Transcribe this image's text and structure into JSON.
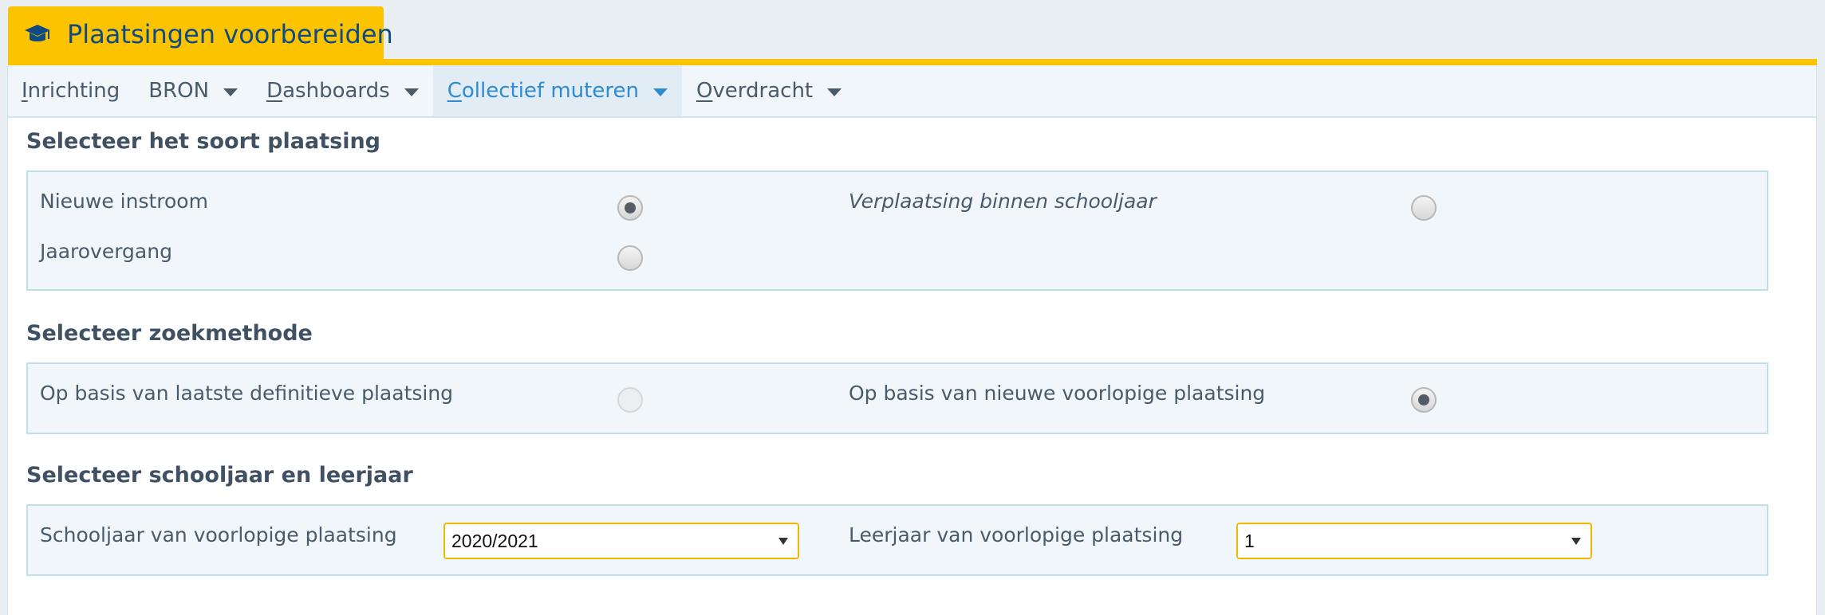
{
  "header": {
    "module_title": "Plaatsingen voorbereiden",
    "user_info": "...",
    "accent_color": "#fcc300",
    "title_color": "#0f4a85"
  },
  "nav": {
    "items": [
      {
        "label": "Inrichting",
        "access_key": "I",
        "rest": "nrichting",
        "dropdown": false,
        "active": false
      },
      {
        "label": "BRON",
        "dropdown": true,
        "active": false
      },
      {
        "label": "Dashboards",
        "access_key": "D",
        "rest": "ashboards",
        "dropdown": true,
        "active": false
      },
      {
        "label": "Collectief muteren",
        "access_key": "C",
        "rest": "ollectief muteren",
        "dropdown": true,
        "active": true
      },
      {
        "label": "Overdracht",
        "access_key": "O",
        "rest": "verdracht",
        "dropdown": true,
        "active": false
      }
    ],
    "active_color": "#2e8bd1"
  },
  "soort": {
    "title": "Selecteer het soort plaatsing",
    "options": [
      {
        "label": "Nieuwe instroom",
        "checked": true
      },
      {
        "label": "Verplaatsing binnen schooljaar",
        "checked": false
      },
      {
        "label": "Jaarovergang",
        "checked": false
      }
    ]
  },
  "zoekmethode": {
    "title": "Selecteer zoekmethode",
    "options": [
      {
        "label": "Op basis van laatste definitieve plaatsing",
        "checked": false,
        "disabled": true
      },
      {
        "label": "Op basis van nieuwe voorlopige plaatsing",
        "checked": true,
        "disabled": false
      }
    ]
  },
  "schooljaar": {
    "title": "Selecteer schooljaar en leerjaar",
    "schooljaar_label": "Schooljaar van voorlopige plaatsing",
    "schooljaar_value": "2020/2021",
    "leerjaar_label": "Leerjaar van voorlopige plaatsing",
    "leerjaar_value": "1"
  }
}
